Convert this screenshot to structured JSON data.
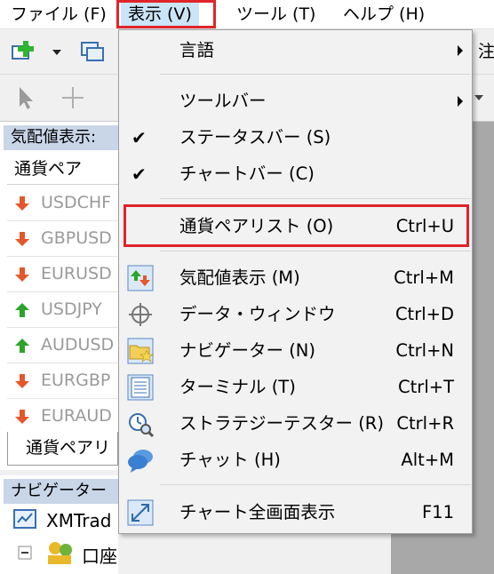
{
  "menubar": {
    "items": [
      "ファイル (F)",
      "表示 (V)",
      "ツール (T)",
      "ヘルプ (H)"
    ]
  },
  "toolbar": {
    "right_fragment": "注"
  },
  "market_watch": {
    "title": "気配値表示:",
    "column_header": "通貨ペア",
    "symbols": [
      {
        "name": "USDCHF",
        "direction": "down"
      },
      {
        "name": "GBPUSD",
        "direction": "down"
      },
      {
        "name": "EURUSD",
        "direction": "down"
      },
      {
        "name": "USDJPY",
        "direction": "up"
      },
      {
        "name": "AUDUSD",
        "direction": "up"
      },
      {
        "name": "EURGBP",
        "direction": "down"
      },
      {
        "name": "EURAUD",
        "direction": "down"
      }
    ],
    "tab_label": "通貨ペアリ"
  },
  "navigator": {
    "title": "ナビゲーター",
    "root_item": "XMTrad",
    "child_item": "口座"
  },
  "view_menu": {
    "items": [
      {
        "label": "言語",
        "shortcut": "",
        "submenu": true,
        "checked": false,
        "icon": ""
      },
      {
        "label": "ツールバー",
        "shortcut": "",
        "submenu": true,
        "checked": false,
        "icon": ""
      },
      {
        "label": "ステータスバー (S)",
        "shortcut": "",
        "submenu": false,
        "checked": true,
        "icon": ""
      },
      {
        "label": "チャートバー (C)",
        "shortcut": "",
        "submenu": false,
        "checked": true,
        "icon": ""
      },
      {
        "label": "通貨ペアリスト (O)",
        "shortcut": "Ctrl+U",
        "submenu": false,
        "checked": false,
        "icon": "",
        "highlighted": true
      },
      {
        "label": "気配値表示 (M)",
        "shortcut": "Ctrl+M",
        "submenu": false,
        "checked": false,
        "icon": "market-watch-icon"
      },
      {
        "label": "データ・ウィンドウ",
        "shortcut": "Ctrl+D",
        "submenu": false,
        "checked": false,
        "icon": "crosshair-icon"
      },
      {
        "label": "ナビゲーター (N)",
        "shortcut": "Ctrl+N",
        "submenu": false,
        "checked": false,
        "icon": "navigator-folder-icon"
      },
      {
        "label": "ターミナル (T)",
        "shortcut": "Ctrl+T",
        "submenu": false,
        "checked": false,
        "icon": "terminal-icon"
      },
      {
        "label": "ストラテジーテスター (R)",
        "shortcut": "Ctrl+R",
        "submenu": false,
        "checked": false,
        "icon": "strategy-tester-icon"
      },
      {
        "label": "チャット (H)",
        "shortcut": "Alt+M",
        "submenu": false,
        "checked": false,
        "icon": "chat-icon"
      },
      {
        "label": "チャート全画面表示",
        "shortcut": "F11",
        "submenu": false,
        "checked": false,
        "icon": "fullscreen-icon"
      }
    ]
  },
  "colors": {
    "highlight_red": "#e0242b",
    "arrow_up": "#2aa52a",
    "arrow_down": "#e5562a",
    "menu_hover": "#cce4f7"
  }
}
